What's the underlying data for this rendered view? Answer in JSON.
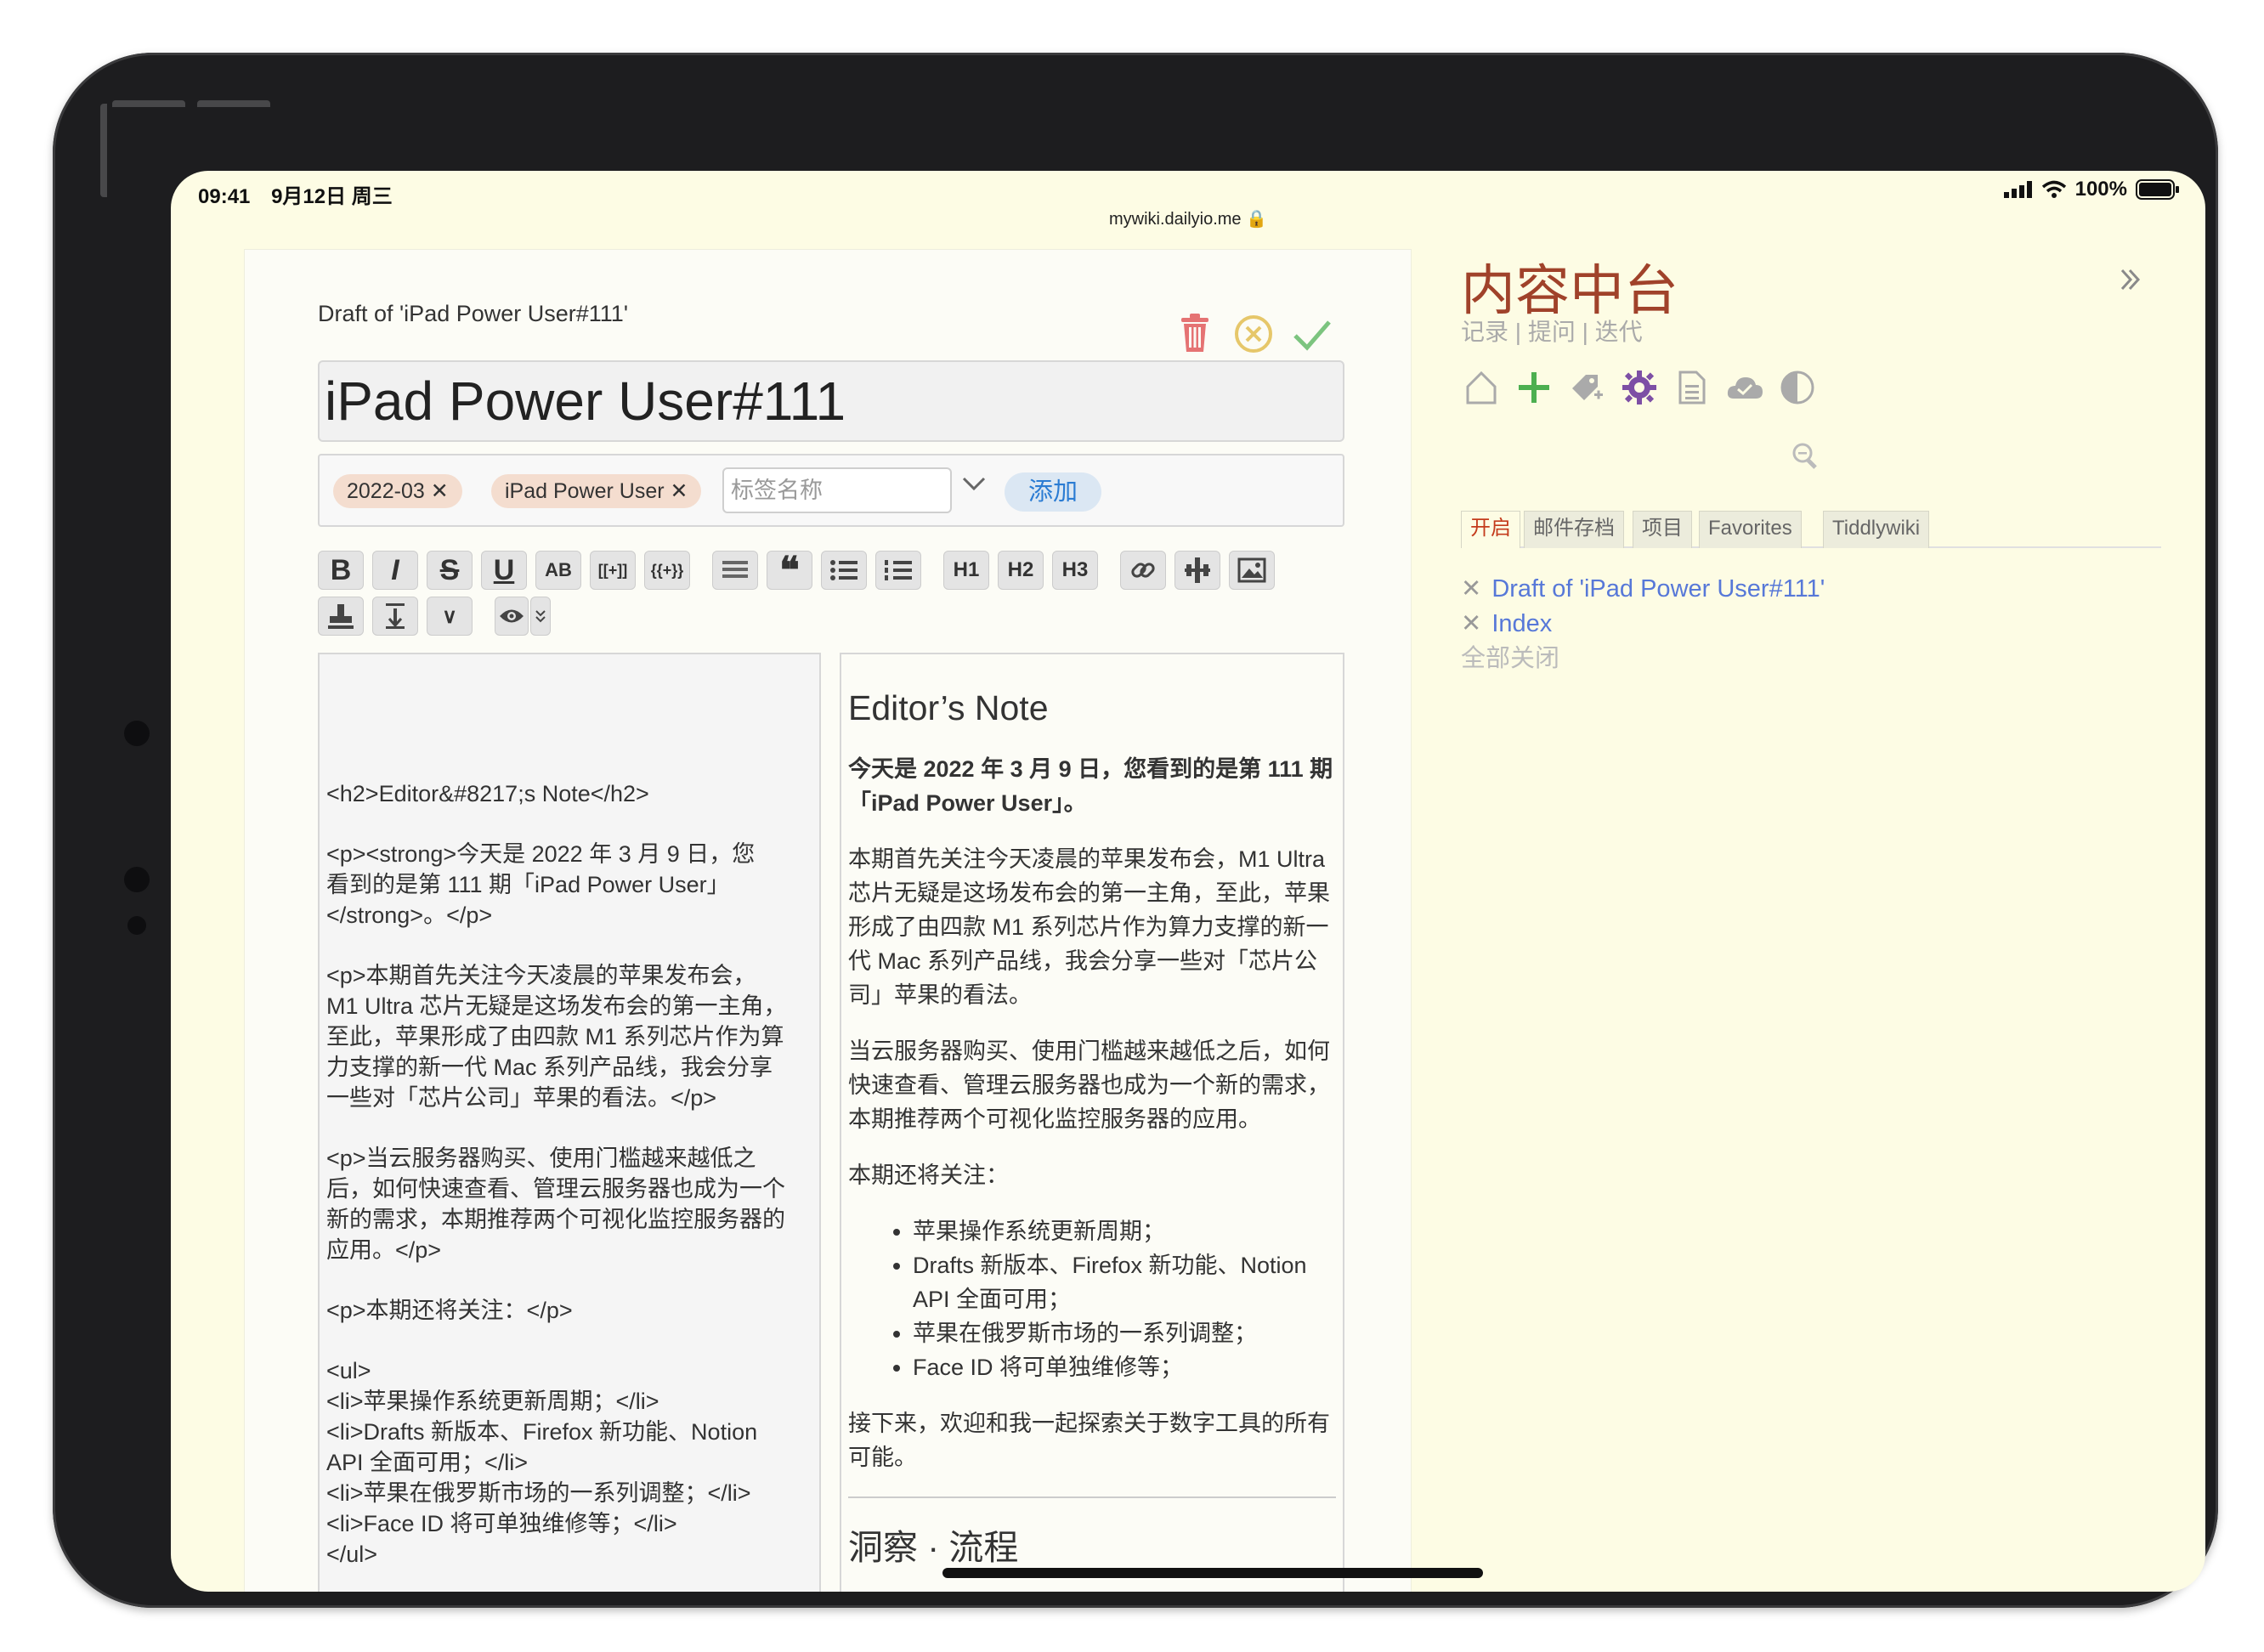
{
  "status": {
    "time": "09:41",
    "date": "9月12日 周三",
    "battery": "100%"
  },
  "url": "mywiki.dailyio.me 🔒",
  "tiddler": {
    "draft_label": "Draft of 'iPad Power User#111'",
    "title": "iPad Power User#111",
    "tags": [
      "2022-03 ✕",
      "iPad Power User ✕"
    ],
    "tag_placeholder": "标签名称",
    "add_label": "添加",
    "toolbar_row2": {
      "expand": "∨"
    }
  },
  "toolbar": {
    "bold": "B",
    "italic": "I",
    "strike": "S",
    "underline": "U",
    "smallcaps": "AB",
    "link_wiki": "[[+]]",
    "transclude": "{{+}}",
    "quote": "❝",
    "h1": "H1",
    "h2": "H2",
    "h3": "H3"
  },
  "editor_text": {
    "p1": "<h2>Editor&#8217;s Note</h2>",
    "p2": "<p><strong>今天是 2022 年 3 月 9 日，您\n看到的是第 111 期「iPad Power User」\n</strong>。</p>",
    "p3": "<p>本期首先关注今天凌晨的苹果发布会，\nM1 Ultra 芯片无疑是这场发布会的第一主角，\n至此，苹果形成了由四款 M1 系列芯片作为算\n力支撑的新一代 Mac 系列产品线，我会分享\n一些对「芯片公司」苹果的看法。</p>",
    "p4": "<p>当云服务器购买、使用门槛越来越低之\n后，如何快速查看、管理云服务器也成为一个\n新的需求，本期推荐两个可视化监控服务器的\n应用。</p>",
    "p5": "<p>本期还将关注：</p>",
    "p6": "<ul>\n<li>苹果操作系统更新周期；</li>\n<li>Drafts 新版本、Firefox 新功能、Notion\nAPI 全面可用；</li>\n<li>苹果在俄罗斯市场的一系列调整；</li>\n<li>Face ID 将可单独维修等；</li>\n</ul>"
  },
  "preview": {
    "heading": "Editor’s Note",
    "strong": "今天是 2022 年 3 月 9 日，您看到的是第 111 期「iPad Power User」。",
    "para1": "本期首先关注今天凌晨的苹果发布会，M1 Ultra 芯片无疑是这场发布会的第一主角，至此，苹果形成了由四款 M1 系列芯片作为算力支撑的新一代 Mac 系列产品线，我会分享一些对「芯片公司」苹果的看法。",
    "para2": "当云服务器购买、使用门槛越来越低之后，如何快速查看、管理云服务器也成为一个新的需求，本期推荐两个可视化监控服务器的应用。",
    "para3": "本期还将关注：",
    "list": [
      "苹果操作系统更新周期；",
      "Drafts 新版本、Firefox 新功能、Notion API 全面可用；",
      "苹果在俄罗斯市场的一系列调整；",
      "Face ID 将可单独维修等；"
    ],
    "para4": "接下来，欢迎和我一起探索关于数字工具的所有可能。",
    "next_heading": "洞察 · 流程"
  },
  "sidebar": {
    "title": "内容中台",
    "subtitle": "记录 | 提问 | 迭代",
    "tabs": [
      "开启",
      "邮件存档",
      "项目",
      "Favorites",
      "Tiddlywiki"
    ],
    "open": [
      "Draft of 'iPad Power User#111'",
      "Index"
    ],
    "close_all": "全部关闭"
  },
  "colors": {
    "background": "#fdfce4",
    "title_red": "#a0422a",
    "link_blue": "#5778d8",
    "accent_green": "#4caf50",
    "delete_red": "#e57373"
  }
}
